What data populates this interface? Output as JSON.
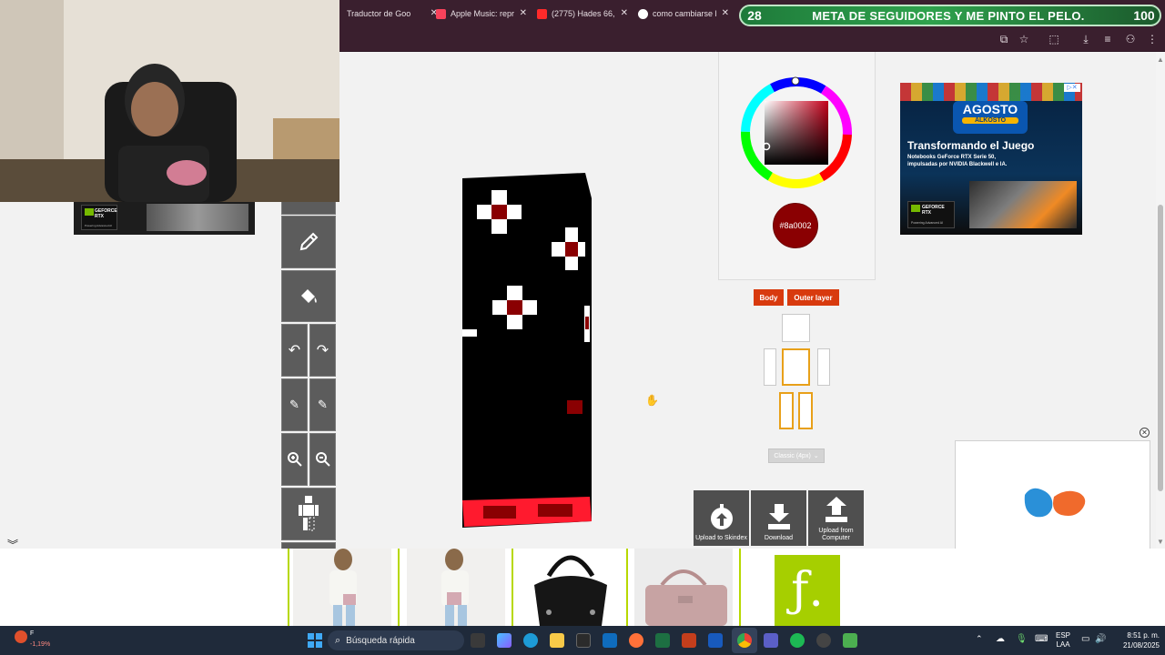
{
  "tabs": [
    {
      "label": "Traductor de Goo",
      "color": "#4a8af4"
    },
    {
      "label": "Apple Music: repr",
      "color": "#f8425b"
    },
    {
      "label": "(2775) Hades 66,",
      "color": "#ff2a2a"
    },
    {
      "label": "como cambiarse l",
      "color": "#ffffff"
    }
  ],
  "goal": {
    "count": "28",
    "text": "META DE SEGUIDORES Y ME PINTO EL PELO.",
    "target": "100"
  },
  "ads": {
    "left": {
      "badge": "GEFORCE RTX",
      "sub": "Powering Advanced AI"
    },
    "right": {
      "logo_top": "AGOSTO",
      "logo_bottom": "ALKOSTO",
      "headline": "Transformando el Juego",
      "body": "Notebooks GeForce RTX Serie 50, impulsadas por NVIDIA Blackwell e IA.",
      "badge": "GEFORCE RTX",
      "sub": "Powering Advanced AI"
    }
  },
  "color_picker": {
    "hex": "#8a0002"
  },
  "layers": {
    "body": "Body",
    "outer": "Outer layer"
  },
  "model_select": "Classic (4px)",
  "actions": [
    {
      "label": "Upload to Skindex"
    },
    {
      "label": "Download"
    },
    {
      "label": "Upload from Computer"
    }
  ],
  "taskbar": {
    "search_placeholder": "Búsqueda rápida",
    "stock_symbol": "F",
    "stock_change": "-1,19%",
    "lang_top": "ESP",
    "lang_bottom": "LAA",
    "time": "8:51 p. m.",
    "date": "21/08/2025"
  },
  "colors": {
    "accent": "#d83a0e",
    "selected": "#8a0002",
    "goal": "#2fa24d"
  }
}
